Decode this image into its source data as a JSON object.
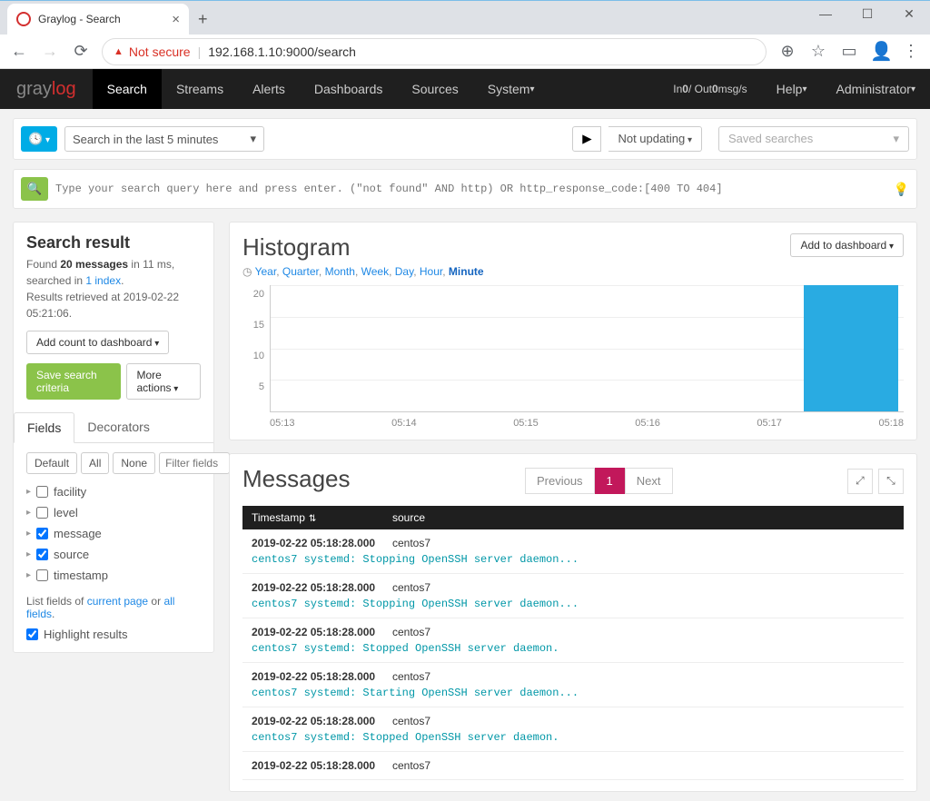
{
  "window": {
    "title": "Graylog - Search"
  },
  "browser": {
    "back": "←",
    "forward": "→",
    "reload": "↻",
    "not_secure": "Not secure",
    "url": "192.168.1.10:9000/search"
  },
  "nav": {
    "brand_gray": "gray",
    "brand_log": "log",
    "items": [
      "Search",
      "Streams",
      "Alerts",
      "Dashboards",
      "Sources",
      "System"
    ],
    "in_out": "In 0 / Out 0 msg/s",
    "help": "Help",
    "admin": "Administrator"
  },
  "searchbar": {
    "time_range": "Search in the last 5 minutes",
    "updating": "Not updating",
    "saved_placeholder": "Saved searches",
    "query_placeholder": "Type your search query here and press enter. (\"not found\" AND http) OR http_response_code:[400 TO 404]"
  },
  "search_result": {
    "title": "Search result",
    "found": "Found ",
    "count": "20 messages",
    "in_ms": " in 11 ms, searched in ",
    "index_link": "1 index",
    "period": ".",
    "retrieved": "Results retrieved at 2019-02-22 05:21:06.",
    "add_count": "Add count to dashboard",
    "save_criteria": "Save search criteria",
    "more_actions": "More actions"
  },
  "tabs": {
    "fields": "Fields",
    "decorators": "Decorators"
  },
  "filters": {
    "default": "Default",
    "all": "All",
    "none": "None",
    "placeholder": "Filter fields"
  },
  "fields": [
    {
      "name": "facility",
      "checked": false
    },
    {
      "name": "level",
      "checked": false
    },
    {
      "name": "message",
      "checked": true
    },
    {
      "name": "source",
      "checked": true
    },
    {
      "name": "timestamp",
      "checked": false
    }
  ],
  "listfields": {
    "pre": "List fields of ",
    "current": "current page",
    "mid": " or ",
    "all": "all fields",
    "post": "."
  },
  "highlight": "Highlight results",
  "histogram": {
    "title": "Histogram",
    "add_dashboard": "Add to dashboard",
    "ranges": [
      "Year",
      "Quarter",
      "Month",
      "Week",
      "Day",
      "Hour",
      "Minute"
    ],
    "active_range": "Minute"
  },
  "chart_data": {
    "type": "bar",
    "categories": [
      "05:13",
      "05:14",
      "05:15",
      "05:16",
      "05:17",
      "05:18"
    ],
    "values": [
      0,
      0,
      0,
      0,
      0,
      20
    ],
    "ylim": [
      0,
      20
    ],
    "yticks": [
      5,
      10,
      15,
      20
    ],
    "title": "",
    "xlabel": "",
    "ylabel": ""
  },
  "messages": {
    "title": "Messages",
    "prev": "Previous",
    "page": "1",
    "next": "Next",
    "col_ts": "Timestamp",
    "col_src": "source",
    "rows": [
      {
        "ts": "2019-02-22 05:18:28.000",
        "src": "centos7",
        "body": "centos7 systemd: Stopping OpenSSH server daemon..."
      },
      {
        "ts": "2019-02-22 05:18:28.000",
        "src": "centos7",
        "body": "centos7 systemd: Stopping OpenSSH server daemon..."
      },
      {
        "ts": "2019-02-22 05:18:28.000",
        "src": "centos7",
        "body": "centos7 systemd: Stopped OpenSSH server daemon."
      },
      {
        "ts": "2019-02-22 05:18:28.000",
        "src": "centos7",
        "body": "centos7 systemd: Starting OpenSSH server daemon..."
      },
      {
        "ts": "2019-02-22 05:18:28.000",
        "src": "centos7",
        "body": "centos7 systemd: Stopped OpenSSH server daemon."
      },
      {
        "ts": "2019-02-22 05:18:28.000",
        "src": "centos7",
        "body": ""
      }
    ]
  }
}
